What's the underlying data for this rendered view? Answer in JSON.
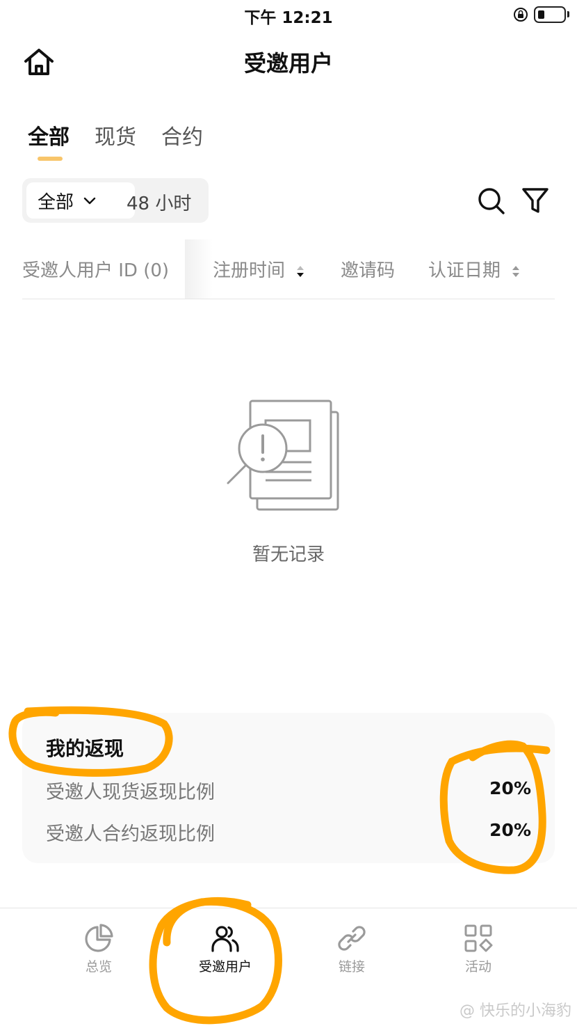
{
  "status_bar": {
    "time": "下午 12:21"
  },
  "header": {
    "title": "受邀用户"
  },
  "tabs": [
    {
      "label": "全部",
      "active": true
    },
    {
      "label": "现货",
      "active": false
    },
    {
      "label": "合约",
      "active": false
    }
  ],
  "filters": {
    "scope_selected": "全部",
    "time_range": "48 小时"
  },
  "table": {
    "columns": [
      "受邀人用户 ID (0)",
      "注册时间",
      "邀请码",
      "认证日期"
    ]
  },
  "empty_state": {
    "text": "暂无记录"
  },
  "rebate": {
    "title": "我的返现",
    "rows": [
      {
        "label": "受邀人现货返现比例",
        "value": "20%"
      },
      {
        "label": "受邀人合约返现比例",
        "value": "20%"
      }
    ]
  },
  "bottom_nav": [
    {
      "label": "总览",
      "icon": "pie-chart-icon",
      "active": false
    },
    {
      "label": "受邀用户",
      "icon": "users-icon",
      "active": true
    },
    {
      "label": "链接",
      "icon": "link-icon",
      "active": false
    },
    {
      "label": "活动",
      "icon": "grid-diamond-icon",
      "active": false
    }
  ],
  "watermark": "@ 快乐的小海豹",
  "colors": {
    "accent_underline": "#f8c56a",
    "annotation_orange": "#ffa500"
  }
}
